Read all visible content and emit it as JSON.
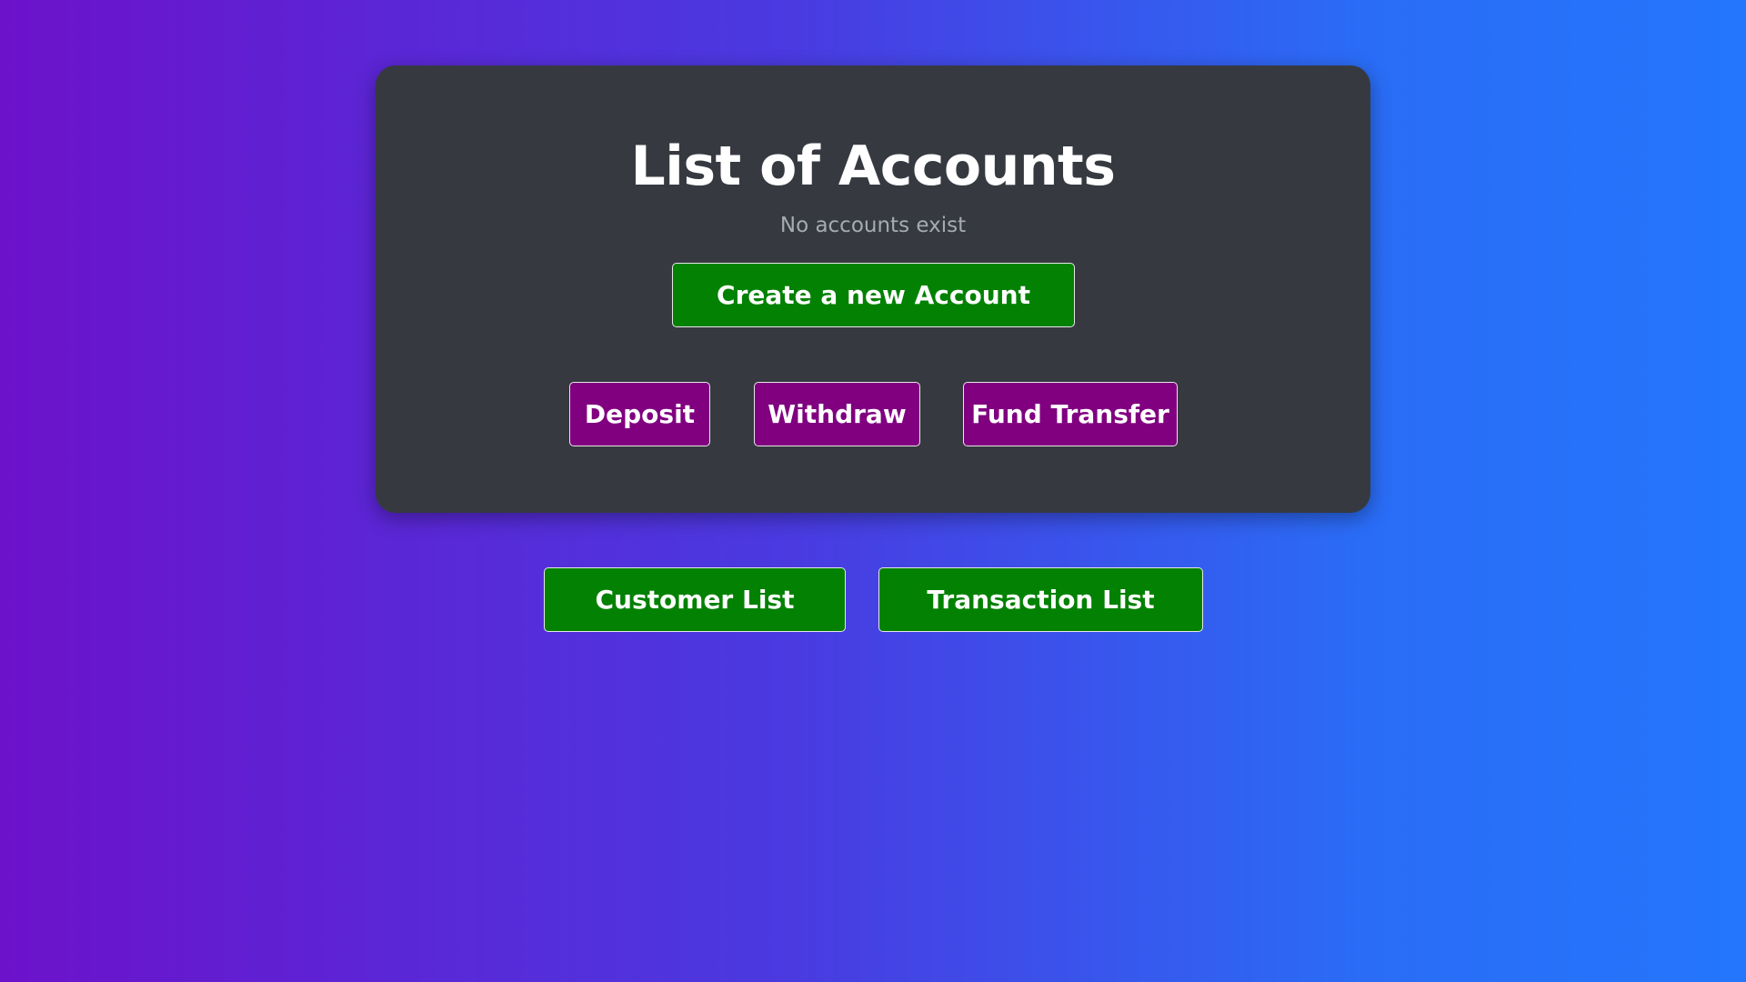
{
  "accounts": {
    "title": "List of Accounts",
    "empty_message": "No accounts exist",
    "create_label": "Create a new Account",
    "actions": {
      "deposit_label": "Deposit",
      "withdraw_label": "Withdraw",
      "fund_transfer_label": "Fund Transfer"
    }
  },
  "nav": {
    "customer_list_label": "Customer List",
    "transaction_list_label": "Transaction List"
  },
  "colors": {
    "background_gradient_start": "#6c12cb",
    "background_gradient_end": "#2476fc",
    "card_background": "#363a40",
    "primary_green": "#038103",
    "action_purple": "#800080",
    "muted_text": "#a6abb2"
  }
}
